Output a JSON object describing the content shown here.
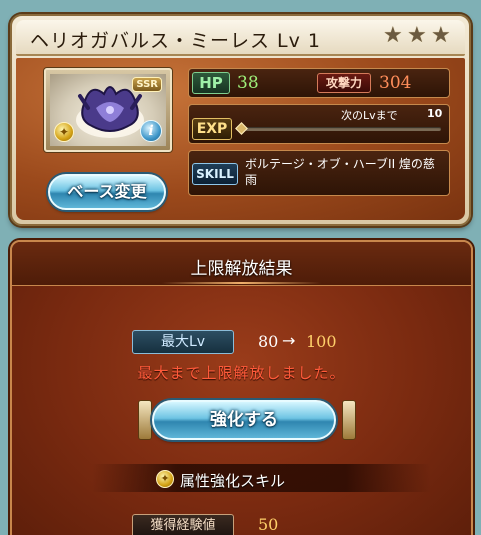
{
  "weapon": {
    "title": "ヘリオガバルス・ミーレス Lv 1",
    "star_icon": "★",
    "stars": 3,
    "rarity_badge": "SSR",
    "element_icon": "✦",
    "info_icon": "i",
    "base_change_label": "ベース変更",
    "hp_label": "HP",
    "hp_value": "38",
    "atk_label": "攻撃力",
    "atk_value": "304",
    "exp_label": "EXP",
    "next_lv_label": "次のLvまで",
    "next_lv_value": "10",
    "exp_progress": 0,
    "skill_label": "SKILL",
    "skill_name": "ボルテージ・オブ・ハーブII 煌の慈雨"
  },
  "result": {
    "title": "上限解放結果",
    "max_lv_label": "最大Lv",
    "lv_from": "80",
    "lv_arrow": "→",
    "lv_to": "100",
    "limit_message": "最大まで上限解放しました。",
    "enhance_label": "強化する",
    "attr_icon": "✦",
    "attr_skill_label": "属性強化スキル",
    "exp_gain_label": "獲得経験値",
    "exp_gain_value": "50"
  },
  "colors": {
    "hp_value": "#9ff07a",
    "atk_value": "#ff8d5a",
    "lv_to": "#ffd06a",
    "limit_message": "#ff5a3a",
    "button_blue": "#6ec4e3"
  },
  "icons": {
    "star": "star-icon",
    "element": "light-element-icon",
    "info": "info-icon",
    "weapon_art": "weapon-portrait"
  }
}
